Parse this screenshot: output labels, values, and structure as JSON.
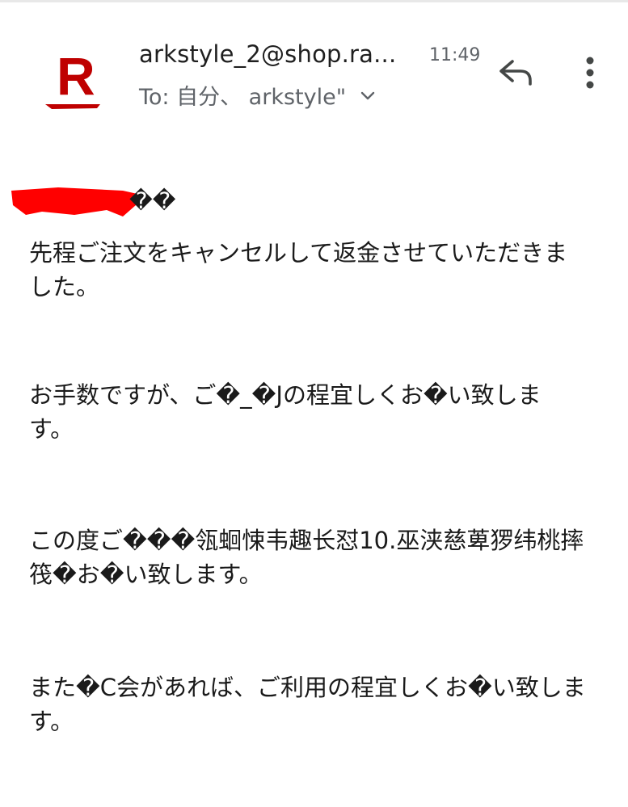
{
  "email": {
    "sender": "arkstyle_2@shop.ra...",
    "time": "11:49",
    "recipients": "To: 自分、 arkstyle\"",
    "greeting_suffix": "��",
    "paragraphs": [
      {
        "line1": "先程ご注文をキャンセルして返金させていただきま",
        "line2": "した。"
      },
      {
        "line1": "お手数ですが、ご�_�Jの程宜しくお�い致しま",
        "line2": "す。"
      },
      {
        "line1": "この度ご���瓴蛔悚韦趣长怼10.巫浃慈萆猡纬桃摔",
        "line2": "筏�お�い致します。"
      },
      {
        "line1": "また�C会があれば、ご利用の程宜しくお�い致しま",
        "line2": "す。"
      }
    ]
  },
  "icons": {
    "avatar": "rakuten-r-logo",
    "reply": "reply-icon",
    "more": "more-vert-icon",
    "expand": "chevron-down-icon"
  },
  "colors": {
    "brand": "#bf0000",
    "redaction": "#ff0000",
    "secondary_text": "#5f6368"
  }
}
